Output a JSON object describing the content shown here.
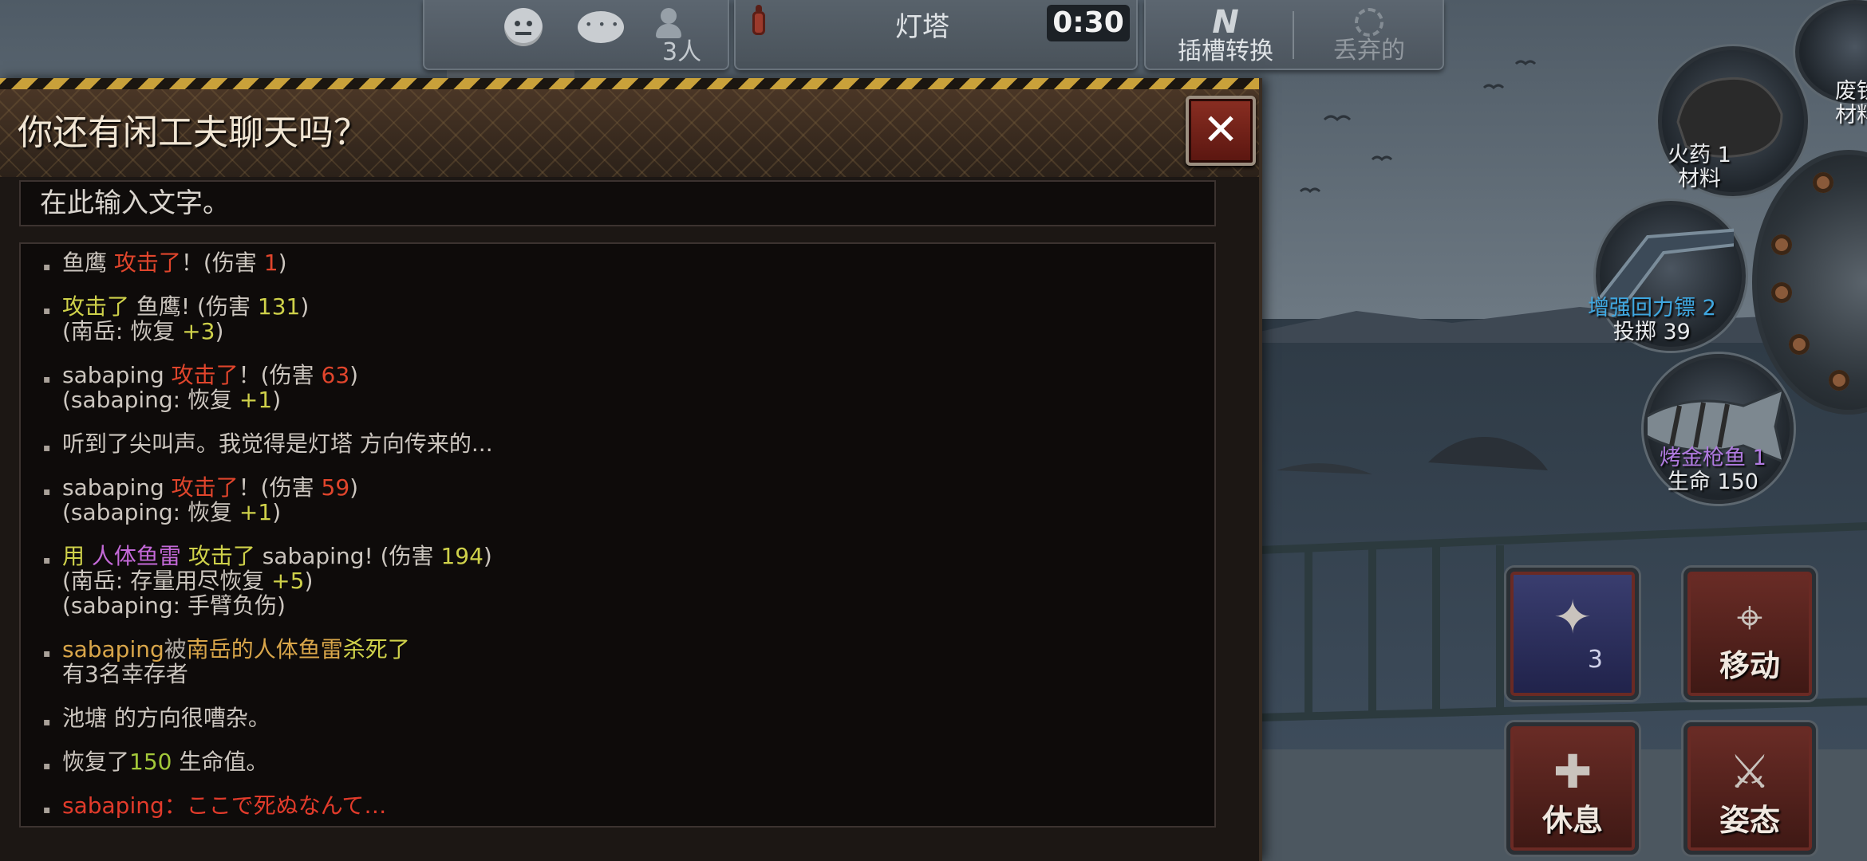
{
  "hud": {
    "player_count": "3人",
    "location_name": "灯塔",
    "timer": "0:30",
    "slot_switch_label": "插槽转换",
    "discard_label": "丢弃的"
  },
  "chat_modal": {
    "title": "你还有闲工夫聊天吗？",
    "close_glyph": "✕",
    "input_placeholder": "在此输入文字。",
    "log": [
      {
        "lines": [
          [
            {
              "t": "鱼鹰  "
            },
            {
              "t": "攻击了",
              "c": "c-red"
            },
            {
              "t": "！(伤害 "
            },
            {
              "t": "1",
              "c": "c-red"
            },
            {
              "t": ")"
            }
          ]
        ]
      },
      {
        "lines": [
          [
            {
              "t": "攻击了",
              "c": "c-yellow"
            },
            {
              "t": "  鱼鹰! (伤害 "
            },
            {
              "t": "131",
              "c": "c-yellow"
            },
            {
              "t": ")"
            }
          ],
          [
            {
              "t": "(南岳: 恢复 "
            },
            {
              "t": "+3",
              "c": "c-yellow"
            },
            {
              "t": ")"
            }
          ]
        ]
      },
      {
        "lines": [
          [
            {
              "t": "sabaping  "
            },
            {
              "t": "攻击了",
              "c": "c-red"
            },
            {
              "t": "！(伤害 "
            },
            {
              "t": "63",
              "c": "c-red"
            },
            {
              "t": ")"
            }
          ],
          [
            {
              "t": "(sabaping: 恢复 "
            },
            {
              "t": "+1",
              "c": "c-yellow"
            },
            {
              "t": ")"
            }
          ]
        ]
      },
      {
        "lines": [
          [
            {
              "t": "听到了尖叫声。我觉得是灯塔 方向传来的..."
            }
          ]
        ]
      },
      {
        "lines": [
          [
            {
              "t": "sabaping  "
            },
            {
              "t": "攻击了",
              "c": "c-red"
            },
            {
              "t": "！(伤害 "
            },
            {
              "t": "59",
              "c": "c-red"
            },
            {
              "t": ")"
            }
          ],
          [
            {
              "t": "(sabaping: 恢复 "
            },
            {
              "t": "+1",
              "c": "c-yellow"
            },
            {
              "t": ")"
            }
          ]
        ]
      },
      {
        "lines": [
          [
            {
              "t": "  用  ",
              "c": "c-yellow"
            },
            {
              "t": "人体鱼雷",
              "c": "c-purple"
            },
            {
              "t": "  攻击了",
              "c": "c-yellow"
            },
            {
              "t": "   sabaping! (伤害 "
            },
            {
              "t": "194",
              "c": "c-yellow"
            },
            {
              "t": ")"
            }
          ],
          [
            {
              "t": "(南岳: 存量用尽恢复 "
            },
            {
              "t": "+5",
              "c": "c-yellow"
            },
            {
              "t": ")"
            }
          ],
          [
            {
              "t": "(sabaping: 手臂负伤)"
            }
          ]
        ]
      },
      {
        "lines": [
          [
            {
              "t": "sabaping",
              "c": "c-orange"
            },
            {
              "t": "被",
              "c": "c-dim"
            },
            {
              "t": "南岳",
              "c": "c-orange"
            },
            {
              "t": "的人体鱼雷",
              "c": "c-orange"
            },
            {
              "t": "杀死了",
              "c": "c-yellow"
            }
          ],
          [
            {
              "t": "有3名幸存者"
            }
          ]
        ]
      },
      {
        "lines": [
          [
            {
              "t": "池塘 的方向很嘈杂。"
            }
          ]
        ]
      },
      {
        "lines": [
          [
            {
              "t": "恢复了"
            },
            {
              "t": "150",
              "c": "c-green"
            },
            {
              "t": " 生命值。"
            }
          ]
        ]
      },
      {
        "lines": [
          [
            {
              "t": "sabaping：ここで死ぬなんて…",
              "c": "c-brightred"
            }
          ]
        ]
      }
    ]
  },
  "items": {
    "gunpowder": {
      "name": "火药 1",
      "type": "材料"
    },
    "scrap": {
      "name": "废铁",
      "type": "材料"
    },
    "boomerang": {
      "name": "增强回力镖 2",
      "type": "投掷 39"
    },
    "tuna": {
      "name": "烤金枪鱼 1",
      "type": "生命 150"
    }
  },
  "actions": {
    "weapon_count": "3",
    "move_label": "移动",
    "rest_label": "休息",
    "stance_label": "姿态"
  },
  "colors": {
    "damage_red": "#e0452c",
    "highlight_yellow": "#cfd14a",
    "heal_green": "#a3c83a",
    "weapon_purple": "#c469d8",
    "boomerang_blue": "#3fa7e0",
    "tuna_purple": "#b07ae0"
  }
}
